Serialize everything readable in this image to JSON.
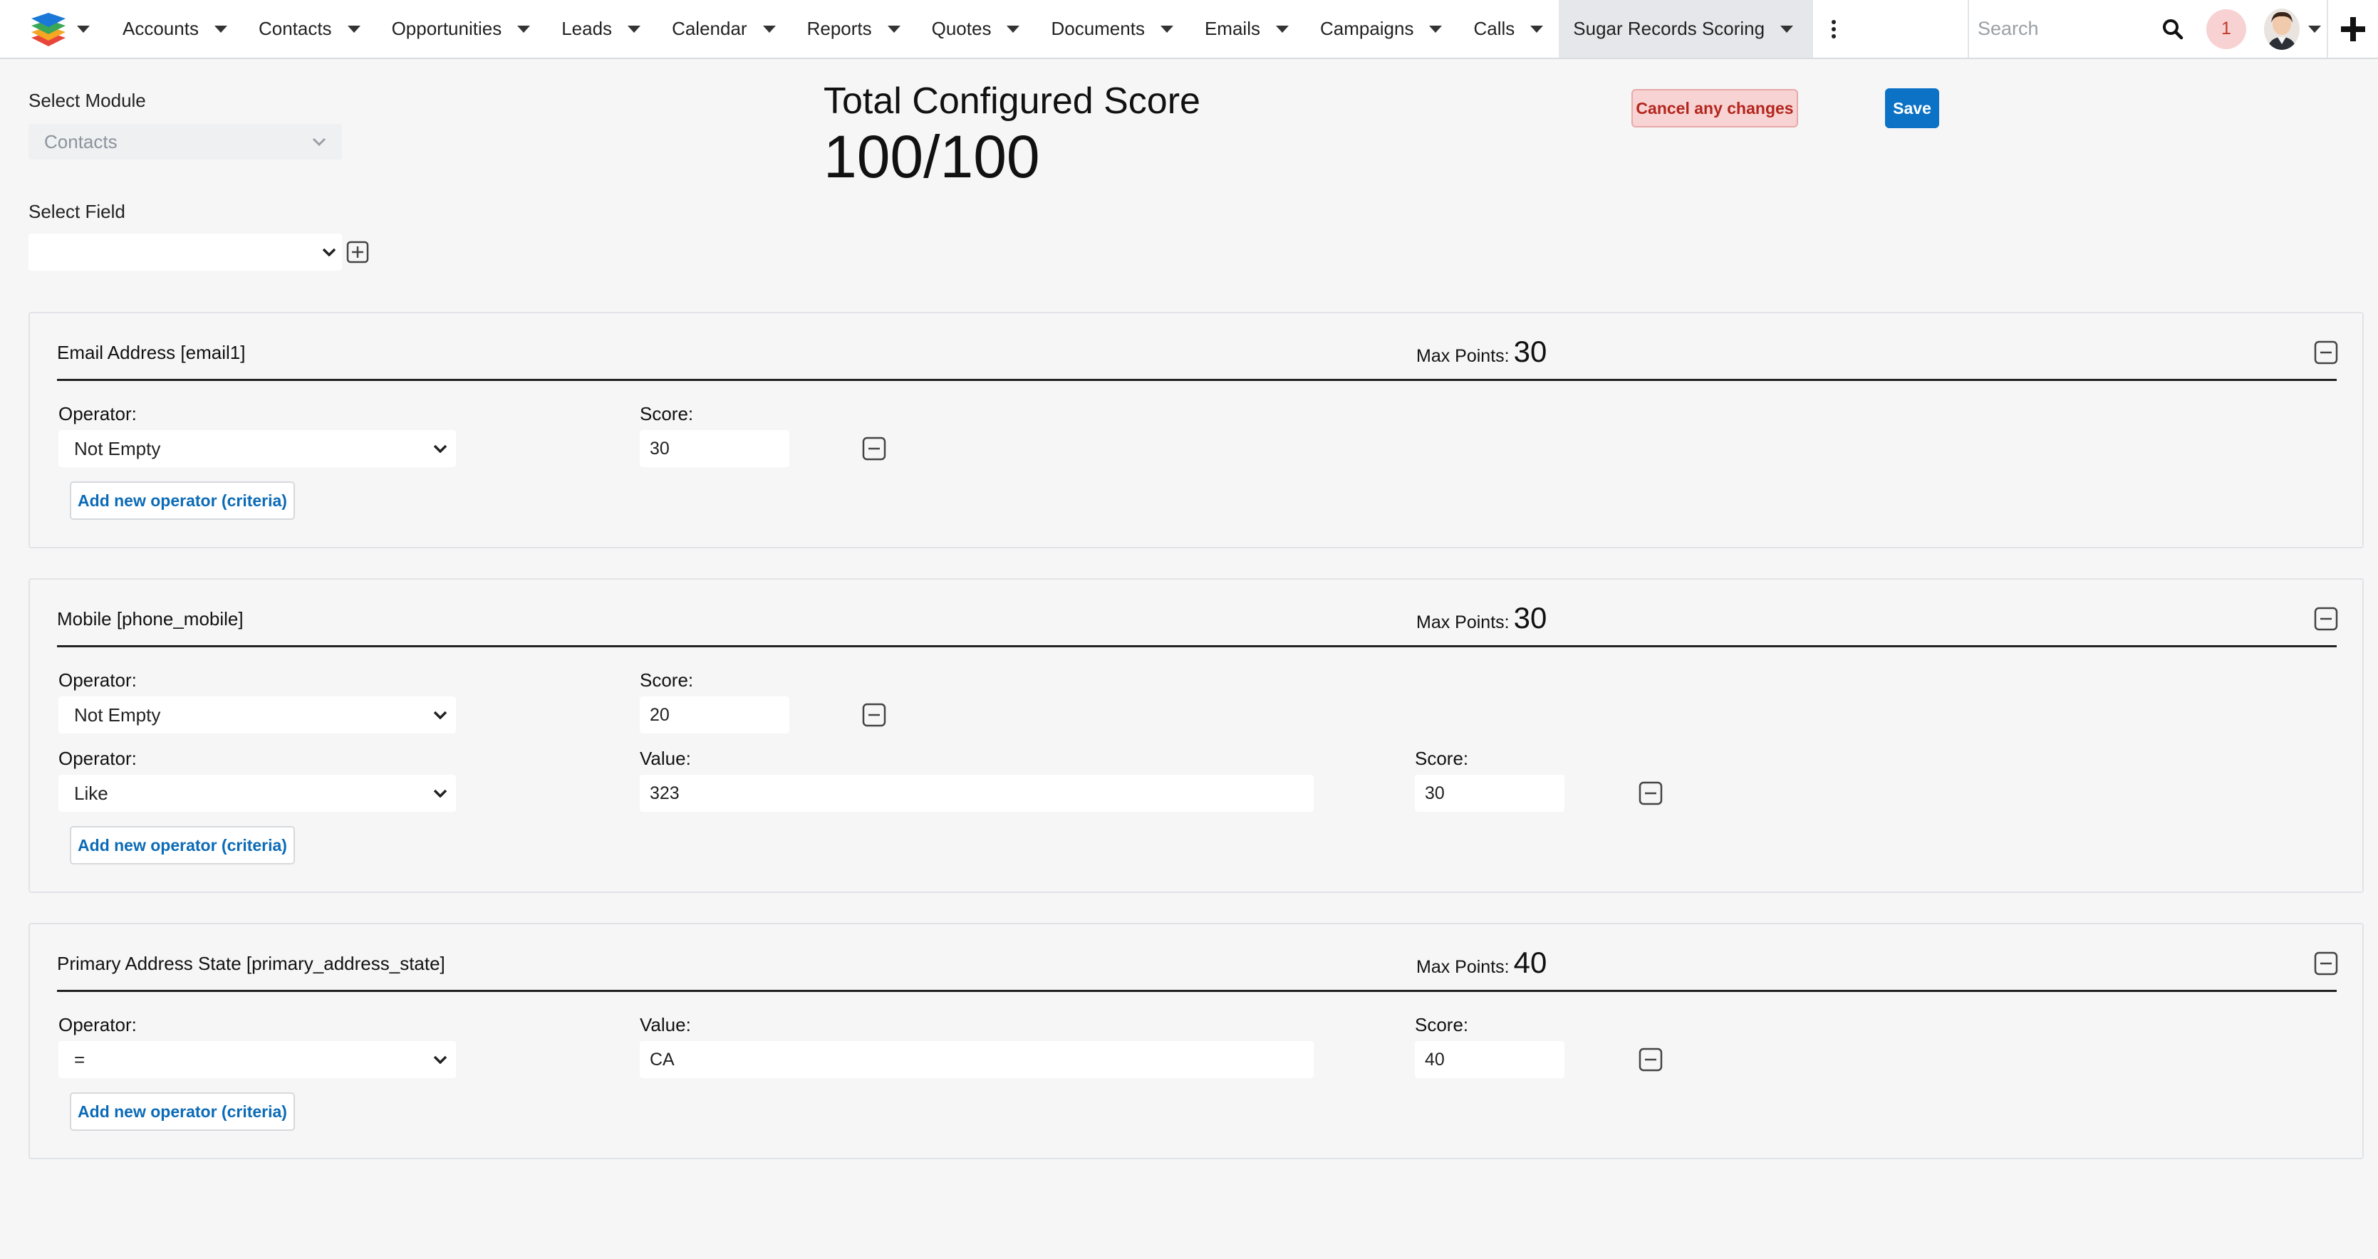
{
  "nav": {
    "items": [
      {
        "label": "Accounts"
      },
      {
        "label": "Contacts"
      },
      {
        "label": "Opportunities"
      },
      {
        "label": "Leads"
      },
      {
        "label": "Calendar"
      },
      {
        "label": "Reports"
      },
      {
        "label": "Quotes"
      },
      {
        "label": "Documents"
      },
      {
        "label": "Emails"
      },
      {
        "label": "Campaigns"
      },
      {
        "label": "Calls"
      },
      {
        "label": "Sugar Records Scoring"
      }
    ],
    "search_placeholder": "Search",
    "notification_count": "1"
  },
  "form": {
    "select_module_label": "Select Module",
    "module_value": "Contacts",
    "select_field_label": "Select Field",
    "field_value": ""
  },
  "score": {
    "title": "Total Configured Score",
    "value": "100/100"
  },
  "actions": {
    "cancel_label": "Cancel any changes",
    "save_label": "Save"
  },
  "panels": [
    {
      "title": "Email Address [email1]",
      "max_points_label": "Max Points:",
      "max_points": "30",
      "operator_label": "Operator:",
      "score_label": "Score:",
      "criteria": [
        {
          "operator": "Not Empty",
          "score": "30"
        }
      ],
      "add_label": "Add new operator (criteria)"
    },
    {
      "title": "Mobile [phone_mobile]",
      "max_points_label": "Max Points:",
      "max_points": "30",
      "operator_label": "Operator:",
      "score_label": "Score:",
      "value_label": "Value:",
      "criteria": [
        {
          "operator": "Not Empty",
          "score": "20"
        },
        {
          "operator": "Like",
          "value": "323",
          "score": "30"
        }
      ],
      "add_label": "Add new operator (criteria)"
    },
    {
      "title": "Primary Address State [primary_address_state]",
      "max_points_label": "Max Points:",
      "max_points": "40",
      "operator_label": "Operator:",
      "score_label": "Score:",
      "value_label": "Value:",
      "criteria": [
        {
          "operator": "=",
          "value": "CA",
          "score": "40"
        }
      ],
      "add_label": "Add new operator (criteria)"
    }
  ],
  "colors": {
    "primary": "#0b72c5",
    "cancel_bg": "#f8d3d3",
    "cancel_text": "#b3261e",
    "page_bg": "#f6f6f7"
  }
}
